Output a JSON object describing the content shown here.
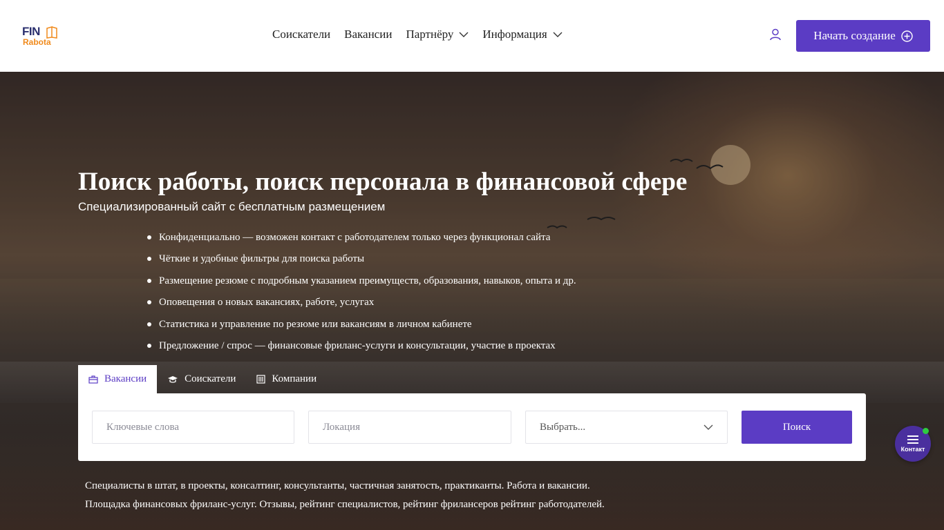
{
  "brand": {
    "logo_line1": "FIN",
    "logo_line2": "Rabota",
    "logo_colors": {
      "primary": "#2a2f6e",
      "secondary": "#f08a1c"
    }
  },
  "nav": {
    "items": [
      {
        "label": "Соискатели",
        "has_dropdown": false
      },
      {
        "label": "Вакансии",
        "has_dropdown": false
      },
      {
        "label": "Партнёру",
        "has_dropdown": true
      },
      {
        "label": "Информация",
        "has_dropdown": true
      }
    ],
    "user_icon": "user-icon",
    "cta_label": "Начать создание",
    "cta_icon": "plus-circle-icon"
  },
  "colors": {
    "accent": "#5b3cc4",
    "online": "#2ecc40"
  },
  "hero": {
    "title": "Поиск работы, поиск персонала в финансовой сфере",
    "subtitle": "Специализированный сайт с бесплатным размещением",
    "features": [
      "Конфиденциально — возможен контакт с работодателем только через функционал сайта",
      "Чёткие и удобные фильтры для поиска работы",
      "Размещение резюме с подробным указанием преимуществ, образования, навыков, опыта и др.",
      "Оповещения о новых вакансиях, работе, услугах",
      "Статистика и управление по резюме или вакансиям в личном кабинете",
      " Предложение / спрос — финансовые фриланс-услуги и консультации, участие в проектах"
    ]
  },
  "search": {
    "tabs": [
      {
        "label": "Вакансии",
        "icon": "briefcase-icon",
        "active": true
      },
      {
        "label": "Соискатели",
        "icon": "graduation-cap-icon",
        "active": false
      },
      {
        "label": "Компании",
        "icon": "building-icon",
        "active": false
      }
    ],
    "keywords_placeholder": "Ключевые слова",
    "location_placeholder": "Локация",
    "select_value": "Выбрать...",
    "button_label": "Поиск"
  },
  "footer_text": {
    "line1": "Специалисты в штат, в проекты, консалтинг, консультанты, частичная занятость, практиканты. Работа и вакансии.",
    "line2": "Площадка финансовых фриланс-услуг. Отзывы, рейтинг специалистов, рейтинг фрилансеров рейтинг работодателей."
  },
  "contact_widget": {
    "label": "Контакт",
    "icon": "menu-icon",
    "online": true
  }
}
